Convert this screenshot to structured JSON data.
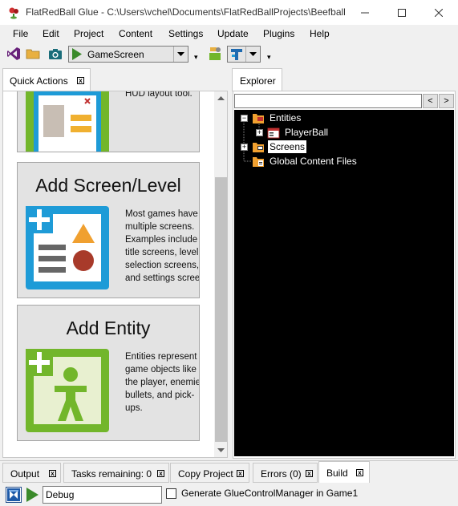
{
  "window": {
    "title": "FlatRedBall Glue - C:\\Users\\vchel\\Documents\\FlatRedBallProjects\\Beefball...",
    "icon": "flatredball-logo-icon"
  },
  "menu": {
    "items": [
      "File",
      "Edit",
      "Project",
      "Content",
      "Settings",
      "Update",
      "Plugins",
      "Help"
    ]
  },
  "toolbar": {
    "startup_screen": "GameScreen"
  },
  "left_panel": {
    "tab_label": "Quick Actions",
    "cards": [
      {
        "title": "",
        "description": "powerful UI and\nHUD layout tool.",
        "icon": "gum-layout-icon"
      },
      {
        "title": "Add Screen/Level",
        "description": "Most games have\nmultiple screens.\nExamples include\ntitle screens, level\nselection screens,\nand settings scree",
        "icon": "add-screen-icon"
      },
      {
        "title": "Add Entity",
        "description": "Entities represent\ngame objects like\nthe player, enemie\nbullets, and pick-\nups.",
        "icon": "add-entity-icon"
      }
    ]
  },
  "right_panel": {
    "tab_label": "Explorer",
    "search_value": "",
    "back_label": "<",
    "forward_label": ">",
    "tree": [
      {
        "label": "Entities",
        "expander": "−",
        "level": 0
      },
      {
        "label": "PlayerBall",
        "expander": "+",
        "level": 1
      },
      {
        "label": "Screens",
        "expander": "+",
        "level": 0,
        "selected": true
      },
      {
        "label": "Global Content Files",
        "expander": "",
        "level": 0
      }
    ]
  },
  "bottom_tabs": [
    "Output",
    "Tasks remaining: 0",
    "Copy Project",
    "Errors (0)",
    "Build"
  ],
  "status_bar": {
    "build_config": "Debug",
    "generate_label": "Generate GlueControlManager in Game1",
    "generate_checked": false
  },
  "colors": {
    "accent_blue": "#1e9bd7",
    "accent_green": "#72b62b",
    "folder_orange": "#f0a030",
    "tree_background": "#000000"
  }
}
